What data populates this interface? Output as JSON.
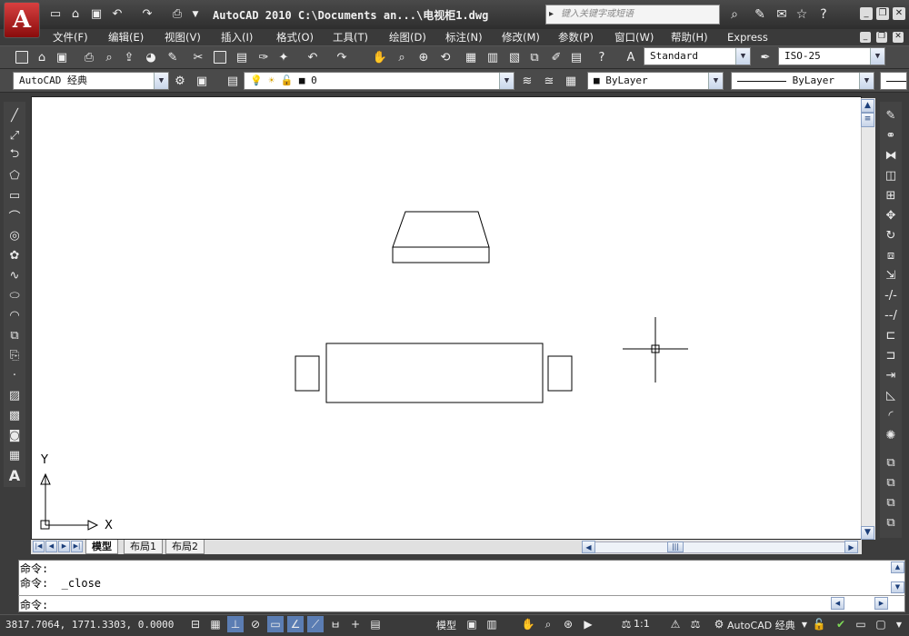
{
  "title": {
    "text": "AutoCAD 2010  C:\\Documents an...\\电视柜1.dwg",
    "search_placeholder": "键入关键字或短语"
  },
  "menu": [
    "文件(F)",
    "编辑(E)",
    "视图(V)",
    "插入(I)",
    "格式(O)",
    "工具(T)",
    "绘图(D)",
    "标注(N)",
    "修改(M)",
    "参数(P)",
    "窗口(W)",
    "帮助(H)",
    "Express"
  ],
  "toolbar": {
    "text_style": "Standard",
    "dim_style": "ISO-25",
    "workspace": "AutoCAD 经典",
    "layer": "0",
    "color": "ByLayer",
    "linetype": "ByLayer"
  },
  "canvas": {
    "ucs_x_label": "X",
    "ucs_y_label": "Y"
  },
  "tabs": [
    "模型",
    "布局1",
    "布局2"
  ],
  "command": {
    "history": [
      "命令:",
      "命令:  _close"
    ],
    "prompt": "命令:"
  },
  "status": {
    "coordinates": "3817.7064, 1771.3303, 0.0000",
    "model_label": "模型",
    "annotation_scale": "1:1",
    "workspace": "AutoCAD 经典"
  },
  "colors": {
    "accent_red": "#c41e1e",
    "canvas_bg": "#ffffff",
    "chrome_dark": "#3c3c3c"
  }
}
